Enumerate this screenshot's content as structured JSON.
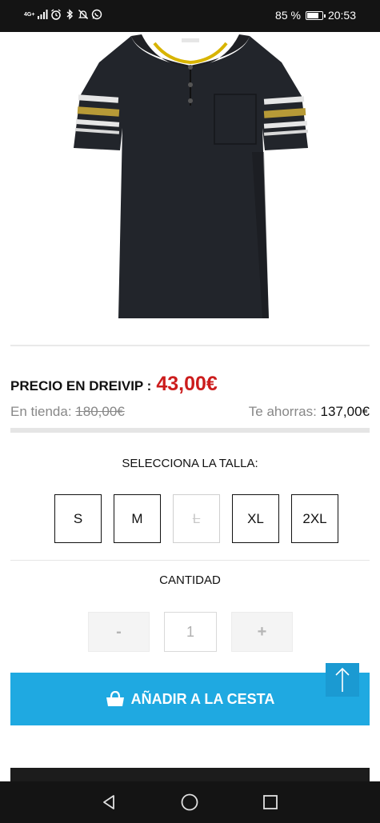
{
  "status_bar": {
    "network_label": "4G+",
    "battery_percent": "85 %",
    "battery_level": 0.85,
    "time": "20:53",
    "icons": [
      "signal-icon",
      "alarm-icon",
      "bluetooth-icon",
      "mute-icon",
      "whatsapp-icon"
    ]
  },
  "product": {
    "image_icon": "polo-shirt-image",
    "price_label": "PRECIO EN DREIVIP :",
    "price": "43,00€",
    "store_label": "En tienda:",
    "store_price": "180,00€",
    "savings_label": "Te ahorras:",
    "savings_value": "137,00€",
    "price_color": "#cc1c1c"
  },
  "size_selector": {
    "title": "SELECCIONA LA TALLA:",
    "sizes": [
      {
        "label": "S",
        "available": true
      },
      {
        "label": "M",
        "available": true
      },
      {
        "label": "L",
        "available": false
      },
      {
        "label": "XL",
        "available": true
      },
      {
        "label": "2XL",
        "available": true
      }
    ]
  },
  "quantity": {
    "title": "CANTIDAD",
    "minus_label": "-",
    "value": "1",
    "plus_label": "+"
  },
  "cart": {
    "add_label": "AÑADIR A LA CESTA",
    "icon": "shopping-basket-icon",
    "button_color": "#1fa9e1"
  },
  "scroll_top": {
    "icon": "arrow-up-icon"
  },
  "nav": {
    "back": "back-icon",
    "home": "home-icon",
    "recents": "recents-icon"
  }
}
